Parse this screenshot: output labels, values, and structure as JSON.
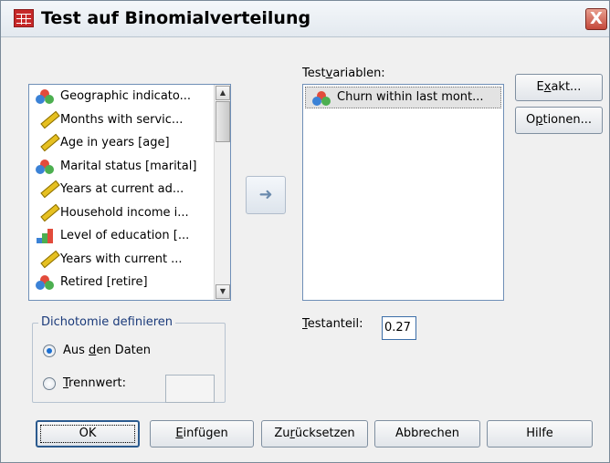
{
  "window": {
    "title": "Test auf Binomialverteilung",
    "close_glyph": "X"
  },
  "source_list": {
    "items": [
      {
        "label": "Geographic indicato...",
        "icon": "nominal-icon"
      },
      {
        "label": "Months with servic...",
        "icon": "scale-icon"
      },
      {
        "label": "Age in years [age]",
        "icon": "scale-icon"
      },
      {
        "label": "Marital status [marital]",
        "icon": "nominal-icon"
      },
      {
        "label": "Years at current ad...",
        "icon": "scale-icon"
      },
      {
        "label": "Household income i...",
        "icon": "scale-icon"
      },
      {
        "label": "Level of education [...",
        "icon": "ordinal-icon"
      },
      {
        "label": "Years with current ...",
        "icon": "scale-icon"
      },
      {
        "label": "Retired [retire]",
        "icon": "nominal-icon"
      }
    ]
  },
  "move_button_glyph": "➜",
  "test_variables": {
    "label_pre": "Test",
    "label_u": "v",
    "label_post": "ariablen:",
    "items": [
      {
        "label": "Churn within last mont...",
        "icon": "nominal-icon"
      }
    ]
  },
  "side_buttons": {
    "exakt_pre": "E",
    "exakt_u": "x",
    "exakt_post": "akt...",
    "optionen_pre": "O",
    "optionen_u": "p",
    "optionen_post": "tionen..."
  },
  "dichotomy": {
    "title": "Dichotomie definieren",
    "from_data_pre": "Aus ",
    "from_data_u": "d",
    "from_data_post": "en Daten",
    "cut_point_u": "T",
    "cut_point_post": "rennwert:",
    "selected": "from_data"
  },
  "test_proportion": {
    "label_u": "T",
    "label_post": "estanteil:",
    "value": "0.27"
  },
  "bottom_buttons": {
    "ok": "OK",
    "einfuegen_u": "E",
    "einfuegen_post": "infügen",
    "zuruecksetzen_pre": "Zu",
    "zuruecksetzen_u": "r",
    "zuruecksetzen_post": "ücksetzen",
    "abbrechen": "Abbrechen",
    "hilfe": "Hilfe"
  }
}
